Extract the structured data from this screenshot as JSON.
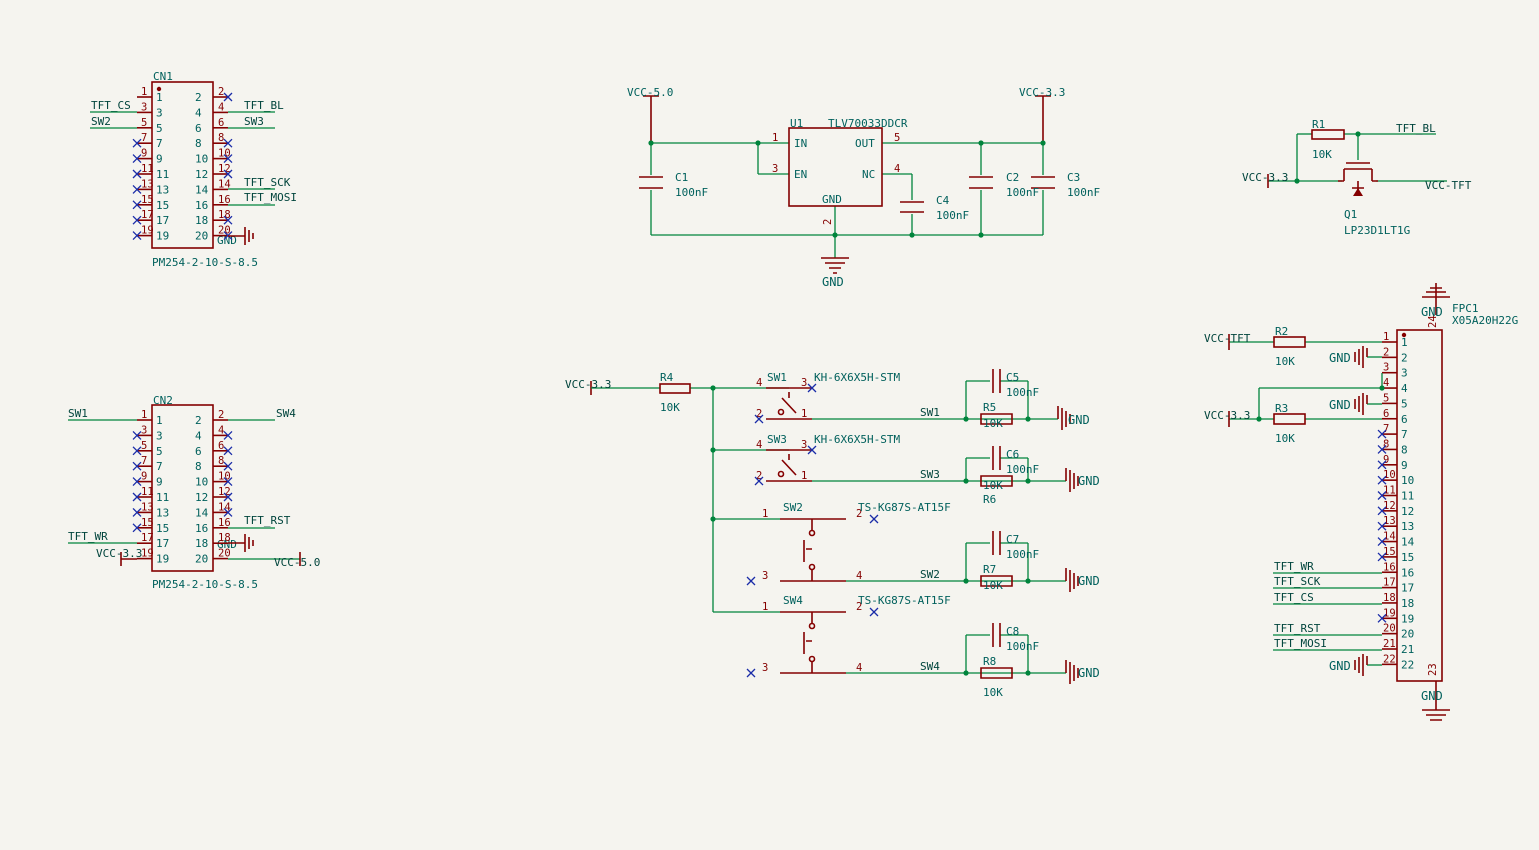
{
  "net": {
    "vcc50": "VCC-5.0",
    "vcc33": "VCC-3.3",
    "vcctft": "VCC-TFT",
    "gnd": "GND",
    "tft_cs": "TFT_CS",
    "tft_bl": "TFT_BL",
    "tft_sck": "TFT_SCK",
    "tft_mosi": "TFT_MOSI",
    "tft_wr": "TFT_WR",
    "tft_rst": "TFT_RST",
    "vcc33_short": "VCC-3.3",
    "sw1": "SW1",
    "sw2": "SW2",
    "sw3": "SW3",
    "sw4": "SW4"
  },
  "cn1": {
    "ref": "CN1",
    "value": "PM254-2-10-S-8.5"
  },
  "cn2": {
    "ref": "CN2",
    "value": "PM254-2-10-S-8.5"
  },
  "u1": {
    "ref": "U1",
    "value": "TLV70033DDCR",
    "pin_in": "IN",
    "pin_en": "EN",
    "pin_out": "OUT",
    "pin_nc": "NC",
    "pin_gnd": "GND"
  },
  "c1": {
    "ref": "C1",
    "value": "100nF"
  },
  "c2": {
    "ref": "C2",
    "value": "100nF"
  },
  "c3": {
    "ref": "C3",
    "value": "100nF"
  },
  "c4": {
    "ref": "C4",
    "value": "100nF"
  },
  "c5": {
    "ref": "C5",
    "value": "100nF"
  },
  "c6": {
    "ref": "C6",
    "value": "100nF"
  },
  "c7": {
    "ref": "C7",
    "value": "100nF"
  },
  "c8": {
    "ref": "C8",
    "value": "100nF"
  },
  "r1": {
    "ref": "R1",
    "value": "10K"
  },
  "r2": {
    "ref": "R2",
    "value": "10K"
  },
  "r3": {
    "ref": "R3",
    "value": "10K"
  },
  "r4": {
    "ref": "R4",
    "value": "10K"
  },
  "r5": {
    "ref": "R5",
    "value": "10K"
  },
  "r6": {
    "ref": "R6",
    "value": "10K"
  },
  "r7": {
    "ref": "R7",
    "value": "10K"
  },
  "r8": {
    "ref": "R8",
    "value": "10K"
  },
  "q1": {
    "ref": "Q1",
    "value": "LP23D1LT1G"
  },
  "sw1": {
    "ref": "SW1",
    "value": "KH-6X6X5H-STM"
  },
  "sw3": {
    "ref": "SW3",
    "value": "KH-6X6X5H-STM"
  },
  "sw2": {
    "ref": "SW2",
    "value": "TS-KG87S-AT15F"
  },
  "sw4": {
    "ref": "SW4",
    "value": "TS-KG87S-AT15F"
  },
  "fpc1": {
    "ref": "FPC1",
    "value": "X05A20H22G"
  }
}
